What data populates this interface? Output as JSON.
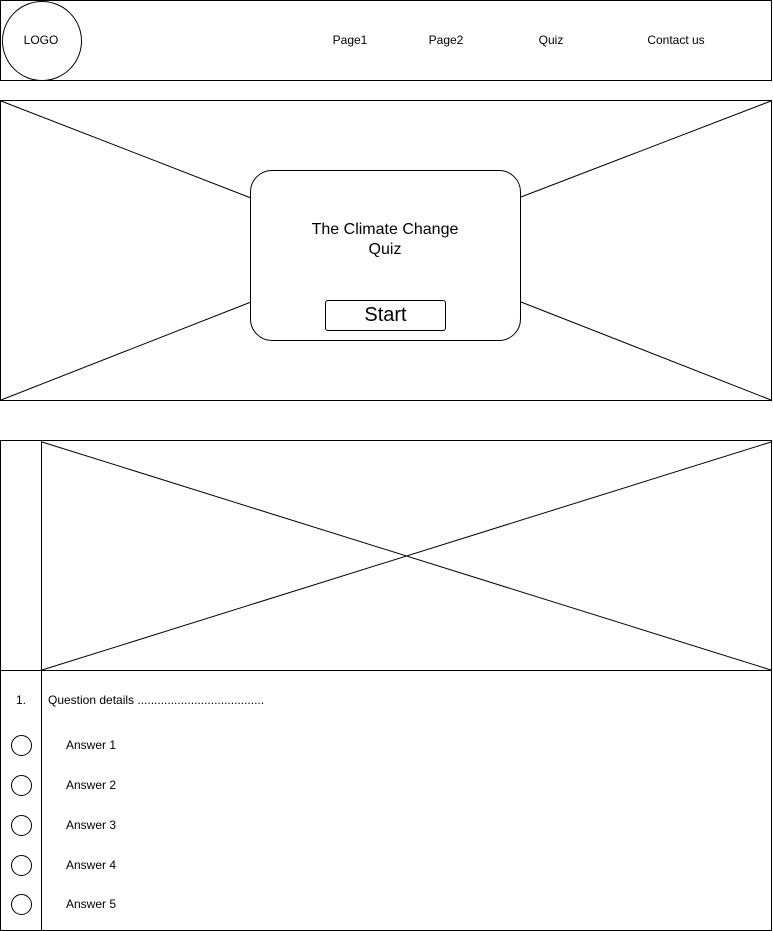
{
  "header": {
    "logo_text": "LOGO",
    "nav": [
      "Page1",
      "Page2",
      "Quiz",
      "Contact us"
    ]
  },
  "hero": {
    "title_line1": "The Climate Change",
    "title_line2": "Quiz",
    "start_label": "Start"
  },
  "quiz": {
    "question_number": "1.",
    "question_text": "Question details ......................................",
    "answers": [
      "Answer 1",
      "Answer 2",
      "Answer 3",
      "Answer 4",
      "Answer 5"
    ]
  }
}
